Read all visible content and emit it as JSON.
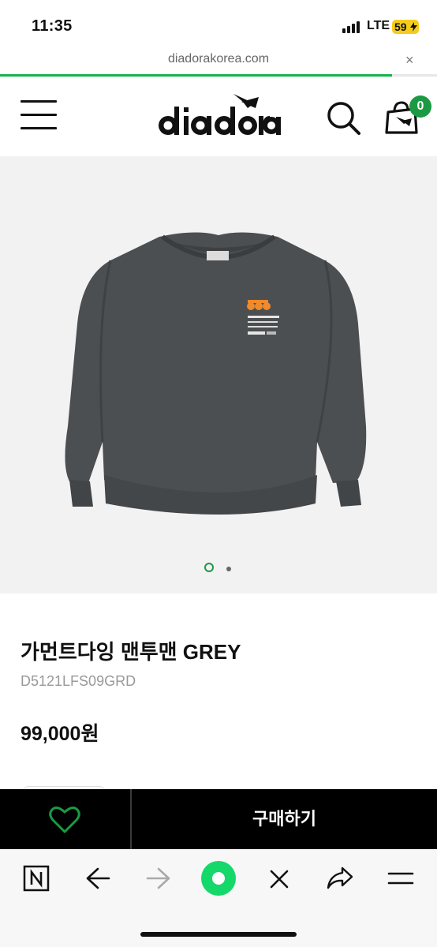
{
  "status": {
    "time": "11:35",
    "network": "LTE",
    "battery": "59"
  },
  "browser": {
    "url": "diadorakorea.com",
    "close_symbol": "×",
    "load_progress_percent": 90
  },
  "header": {
    "brand": "diadora",
    "cart_count": "0"
  },
  "gallery": {
    "image_count": 2,
    "active_index": 0
  },
  "product": {
    "name": "가먼트다잉 맨투맨 GREY",
    "code": "D5121LFS09GRD",
    "price": "99,000원"
  },
  "purchase": {
    "buy_label": "구매하기"
  },
  "colors": {
    "accent": "#1b9a43",
    "bar": "#000000",
    "progress": "#16b24a"
  },
  "toolbar": {
    "icons": [
      "naver-icon",
      "back-icon",
      "forward-icon",
      "green-dot-icon",
      "close-icon",
      "share-icon",
      "menu-icon"
    ]
  }
}
